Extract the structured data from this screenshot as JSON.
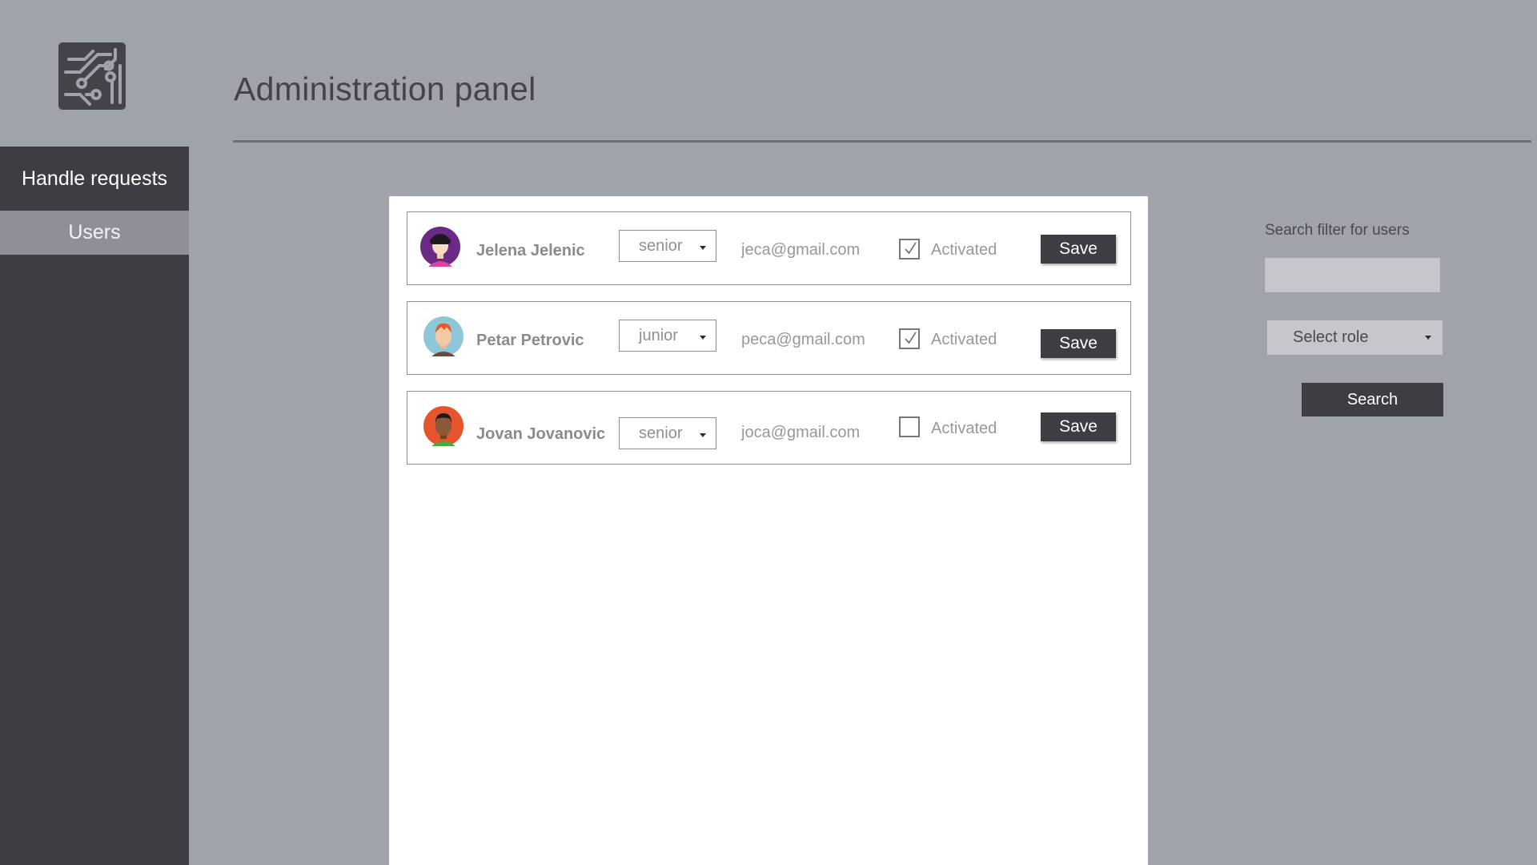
{
  "app": {
    "title": "Administration panel",
    "logo_icon": "circuit-board-icon"
  },
  "sidebar": {
    "items": [
      {
        "label": "Handle requests",
        "active": false
      },
      {
        "label": "Users",
        "active": true
      }
    ]
  },
  "users": [
    {
      "name": "Jelena Jelenic",
      "role": "senior",
      "email": "jeca@gmail.com",
      "activated": true,
      "activated_label": "Activated",
      "save_label": "Save",
      "avatar_icon": "woman-avatar-icon"
    },
    {
      "name": "Petar Petrovic",
      "role": "junior",
      "email": "peca@gmail.com",
      "activated": true,
      "activated_label": "Activated",
      "save_label": "Save",
      "avatar_icon": "man-redhair-avatar-icon"
    },
    {
      "name": "Jovan Jovanovic",
      "role": "senior",
      "email": "joca@gmail.com",
      "activated": false,
      "activated_label": "Activated",
      "save_label": "Save",
      "avatar_icon": "man-darkskin-avatar-icon"
    }
  ],
  "search_panel": {
    "label": "Search filter for users",
    "input_value": "",
    "role_select": "Select role",
    "search_label": "Search"
  },
  "colors": {
    "background": "#a0a3ab",
    "sidebar": "#3f3d44",
    "sidebar_active": "#8f9097",
    "button": "#3f3d44",
    "panel": "#ffffff"
  }
}
